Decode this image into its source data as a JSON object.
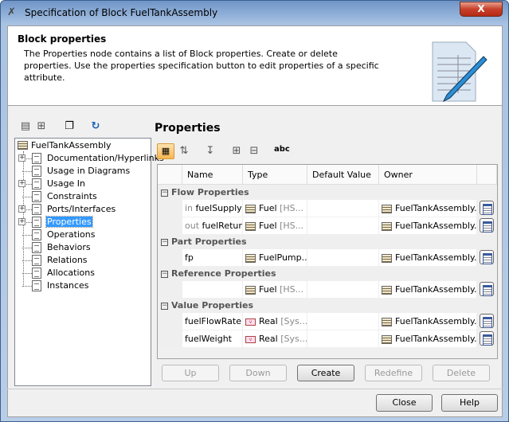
{
  "window": {
    "title": "Specification of Block FuelTankAssembly",
    "close_glyph": "X"
  },
  "header": {
    "title": "Block properties",
    "description": "The Properties node contains a list of Block properties. Create or delete properties. Use the properties specification button to edit properties of a specific attribute."
  },
  "tree": {
    "root": "FuelTankAssembly",
    "items": [
      {
        "label": "Documentation/Hyperlinks",
        "expandable": true
      },
      {
        "label": "Usage in Diagrams",
        "expandable": false
      },
      {
        "label": "Usage In",
        "expandable": true
      },
      {
        "label": "Constraints",
        "expandable": false
      },
      {
        "label": "Ports/Interfaces",
        "expandable": true
      },
      {
        "label": "Properties",
        "expandable": true,
        "selected": true
      },
      {
        "label": "Operations",
        "expandable": false
      },
      {
        "label": "Behaviors",
        "expandable": false
      },
      {
        "label": "Relations",
        "expandable": false
      },
      {
        "label": "Allocations",
        "expandable": false
      },
      {
        "label": "Instances",
        "expandable": false
      }
    ]
  },
  "panel": {
    "title": "Properties"
  },
  "table": {
    "columns": [
      "Name",
      "Type",
      "Default Value",
      "Owner"
    ],
    "groups": [
      {
        "label": "Flow Properties",
        "rows": [
          {
            "prefix": "in",
            "name": "fuelSupply",
            "type": "Fuel",
            "type_suffix": "[HS...",
            "owner": "FuelTankAssembly..."
          },
          {
            "prefix": "out",
            "name": "fuelReturn",
            "type": "Fuel",
            "type_suffix": "[HS...",
            "owner": "FuelTankAssembly..."
          }
        ]
      },
      {
        "label": "Part Properties",
        "rows": [
          {
            "prefix": "",
            "name": "fp",
            "type": "FuelPump...",
            "type_suffix": "",
            "owner": "FuelTankAssembly..."
          }
        ]
      },
      {
        "label": "Reference Properties",
        "rows": [
          {
            "prefix": "",
            "name": "",
            "type": "Fuel",
            "type_suffix": "[HS...",
            "owner": "FuelTankAssembly..."
          }
        ]
      },
      {
        "label": "Value Properties",
        "rows": [
          {
            "prefix": "",
            "name": "fuelFlowRate",
            "type": "Real",
            "type_suffix": "[Sys...",
            "owner": "FuelTankAssembly...",
            "value_type": true
          },
          {
            "prefix": "",
            "name": "fuelWeight",
            "type": "Real",
            "type_suffix": "[Sys...",
            "owner": "FuelTankAssembly...",
            "value_type": true
          }
        ]
      }
    ]
  },
  "buttons": {
    "up": "Up",
    "down": "Down",
    "create": "Create",
    "redefine": "Redefine",
    "delete": "Delete",
    "close": "Close",
    "help": "Help"
  },
  "toolbar": {
    "abc": "abc"
  }
}
